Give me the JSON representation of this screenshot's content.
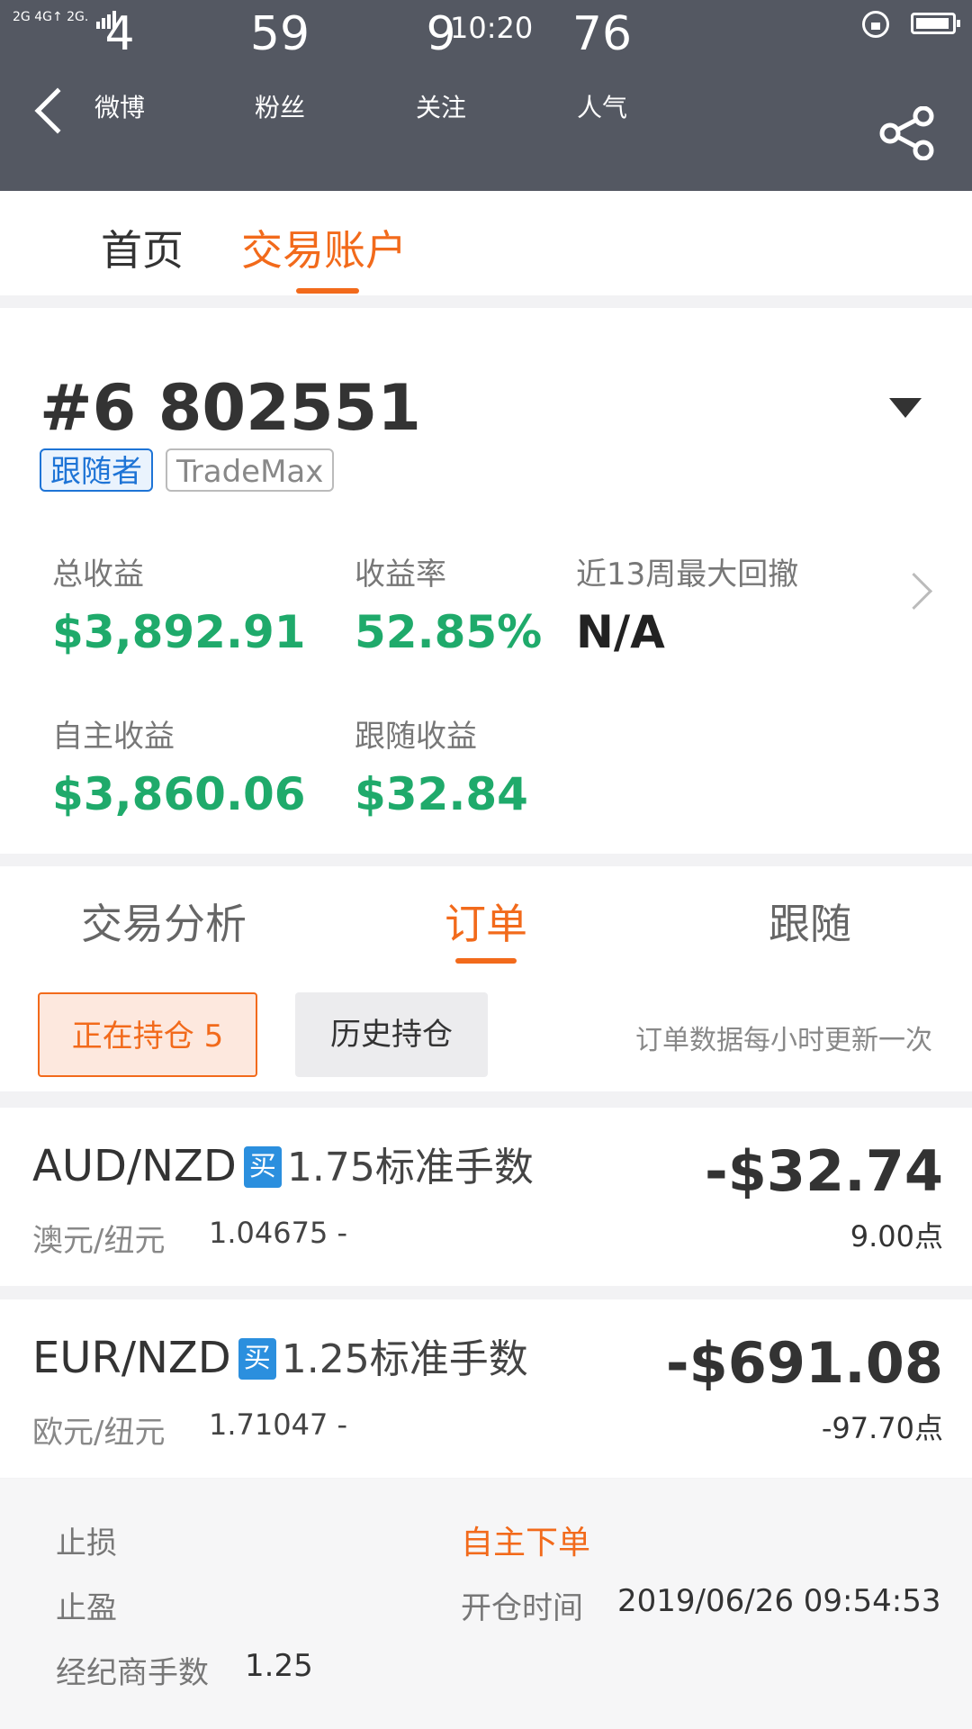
{
  "status_bar": {
    "signal": "2G 4G↑ 2G.",
    "time": "10:20"
  },
  "header": {
    "stats": [
      {
        "value": "4",
        "label": "微博"
      },
      {
        "value": "59",
        "label": "粉丝"
      },
      {
        "value": "9",
        "label": "关注"
      },
      {
        "value": "76",
        "label": "人气"
      }
    ]
  },
  "top_tabs": [
    {
      "label": "首页"
    },
    {
      "label": "交易账户",
      "active": true
    }
  ],
  "account": {
    "number": "#6 802551",
    "role_badge": "跟随者",
    "platform_badge": "TradeMax",
    "metrics": {
      "total_profit_label": "总收益",
      "total_profit_value": "$3,892.91",
      "yield_label": "收益率",
      "yield_value": "52.85%",
      "max_drawdown_label": "近13周最大回撤",
      "max_drawdown_value": "N/A",
      "self_profit_label": "自主收益",
      "self_profit_value": "$3,860.06",
      "follow_profit_label": "跟随收益",
      "follow_profit_value": "$32.84"
    }
  },
  "mid_tabs": [
    {
      "label": "交易分析"
    },
    {
      "label": "订单",
      "active": true
    },
    {
      "label": "跟随"
    }
  ],
  "filters": {
    "open_positions": "正在持仓 5",
    "history_positions": "历史持仓",
    "note": "订单数据每小时更新一次"
  },
  "orders": [
    {
      "pair": "AUD/NZD",
      "side": "买",
      "lots": "1.75标准手数",
      "cn_name": "澳元/纽元",
      "rate": "1.04675 -",
      "pnl": "-$32.74",
      "points": "9.00点"
    },
    {
      "pair": "EUR/NZD",
      "side": "买",
      "lots": "1.25标准手数",
      "cn_name": "欧元/纽元",
      "rate": "1.71047 -",
      "pnl": "-$691.08",
      "points": "-97.70点"
    }
  ],
  "order_detail": {
    "stop_loss_label": "止损",
    "take_profit_label": "止盈",
    "broker_lots_label": "经纪商手数",
    "broker_lots_value": "1.25",
    "order_type": "自主下单",
    "open_time_label": "开仓时间",
    "open_time_value": "2019/06/26 09:54:53"
  },
  "colors": {
    "header_bg": "#545862",
    "accent": "#f26a1b",
    "profit_green": "#1faa6b",
    "badge_blue": "#1e74d6"
  }
}
